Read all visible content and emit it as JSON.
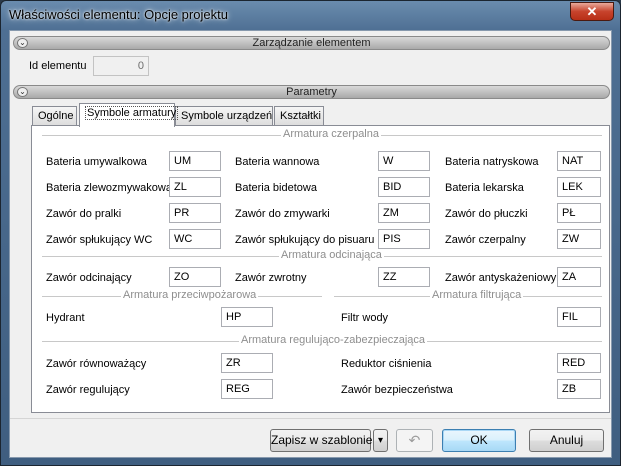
{
  "window": {
    "title": "Właściwości elementu: Opcje projektu",
    "close_label": "✕"
  },
  "section_manage": {
    "title": "Zarządzanie elementem"
  },
  "id_field": {
    "label": "Id elementu",
    "value": "0"
  },
  "section_params": {
    "title": "Parametry"
  },
  "tabs": [
    {
      "label": "Ogólne"
    },
    {
      "label": "Symbole armatury"
    },
    {
      "label": "Symbole urządzeń"
    },
    {
      "label": "Kształtki"
    }
  ],
  "groups": {
    "czerpalna": "Armatura czerpalna",
    "odcinajaca": "Armatura odcinająca",
    "przeciwpozarowa": "Armatura przeciwpożarowa",
    "filtrujaca": "Armatura filtrująca",
    "regulujaco": "Armatura regulująco-zabezpieczająca"
  },
  "fields": {
    "bateria_umywalkowa": {
      "label": "Bateria umywalkowa",
      "value": "UM"
    },
    "bateria_wannowa": {
      "label": "Bateria wannowa",
      "value": "W"
    },
    "bateria_natryskowa": {
      "label": "Bateria natryskowa",
      "value": "NAT"
    },
    "bateria_zlewozmywakowa": {
      "label": "Bateria zlewozmywakowa",
      "value": "ZL"
    },
    "bateria_bidetowa": {
      "label": "Bateria bidetowa",
      "value": "BID"
    },
    "bateria_lekarska": {
      "label": "Bateria lekarska",
      "value": "LEK"
    },
    "zawor_pralki": {
      "label": "Zawór do pralki",
      "value": "PR"
    },
    "zawor_zmywarki": {
      "label": "Zawór do zmywarki",
      "value": "ZM"
    },
    "zawor_pluczki": {
      "label": "Zawór do płuczki",
      "value": "PŁ"
    },
    "zawor_splukujacy_wc": {
      "label": "Zawór spłukujący WC",
      "value": "WC"
    },
    "zawor_splukujacy_pisuar": {
      "label": "Zawór spłukujący do pisuaru",
      "value": "PIS"
    },
    "zawor_czerpalny": {
      "label": "Zawór czerpalny",
      "value": "ZW"
    },
    "zawor_odcinajacy": {
      "label": "Zawór odcinający",
      "value": "ZO"
    },
    "zawor_zwrotny": {
      "label": "Zawór zwrotny",
      "value": "ZZ"
    },
    "zawor_antyskazeniowy": {
      "label": "Zawór antyskażeniowy",
      "value": "ZA"
    },
    "hydrant": {
      "label": "Hydrant",
      "value": "HP"
    },
    "filtr_wody": {
      "label": "Filtr wody",
      "value": "FIL"
    },
    "zawor_rownowazacy": {
      "label": "Zawór równoważący",
      "value": "ZR"
    },
    "reduktor_cisnienia": {
      "label": "Reduktor ciśnienia",
      "value": "RED"
    },
    "zawor_regulujacy": {
      "label": "Zawór regulujący",
      "value": "REG"
    },
    "zawor_bezpieczenstwa": {
      "label": "Zawór bezpieczeństwa",
      "value": "ZB"
    }
  },
  "footer": {
    "save_template": "Zapisz w szablonie",
    "dropdown_glyph": "▾",
    "undo_glyph": "↶",
    "ok": "OK",
    "cancel": "Anuluj"
  }
}
